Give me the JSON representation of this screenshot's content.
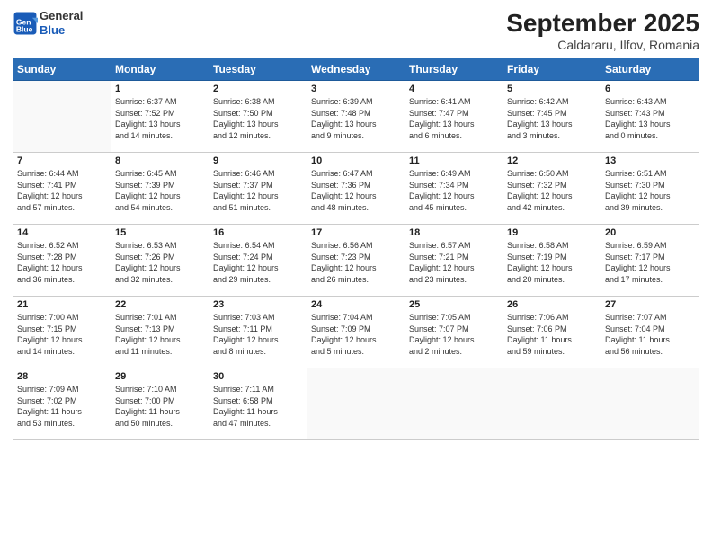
{
  "logo": {
    "general": "General",
    "blue": "Blue"
  },
  "title": "September 2025",
  "subtitle": "Caldararu, Ilfov, Romania",
  "weekdays": [
    "Sunday",
    "Monday",
    "Tuesday",
    "Wednesday",
    "Thursday",
    "Friday",
    "Saturday"
  ],
  "weeks": [
    [
      {
        "day": "",
        "info": ""
      },
      {
        "day": "1",
        "info": "Sunrise: 6:37 AM\nSunset: 7:52 PM\nDaylight: 13 hours\nand 14 minutes."
      },
      {
        "day": "2",
        "info": "Sunrise: 6:38 AM\nSunset: 7:50 PM\nDaylight: 13 hours\nand 12 minutes."
      },
      {
        "day": "3",
        "info": "Sunrise: 6:39 AM\nSunset: 7:48 PM\nDaylight: 13 hours\nand 9 minutes."
      },
      {
        "day": "4",
        "info": "Sunrise: 6:41 AM\nSunset: 7:47 PM\nDaylight: 13 hours\nand 6 minutes."
      },
      {
        "day": "5",
        "info": "Sunrise: 6:42 AM\nSunset: 7:45 PM\nDaylight: 13 hours\nand 3 minutes."
      },
      {
        "day": "6",
        "info": "Sunrise: 6:43 AM\nSunset: 7:43 PM\nDaylight: 13 hours\nand 0 minutes."
      }
    ],
    [
      {
        "day": "7",
        "info": "Sunrise: 6:44 AM\nSunset: 7:41 PM\nDaylight: 12 hours\nand 57 minutes."
      },
      {
        "day": "8",
        "info": "Sunrise: 6:45 AM\nSunset: 7:39 PM\nDaylight: 12 hours\nand 54 minutes."
      },
      {
        "day": "9",
        "info": "Sunrise: 6:46 AM\nSunset: 7:37 PM\nDaylight: 12 hours\nand 51 minutes."
      },
      {
        "day": "10",
        "info": "Sunrise: 6:47 AM\nSunset: 7:36 PM\nDaylight: 12 hours\nand 48 minutes."
      },
      {
        "day": "11",
        "info": "Sunrise: 6:49 AM\nSunset: 7:34 PM\nDaylight: 12 hours\nand 45 minutes."
      },
      {
        "day": "12",
        "info": "Sunrise: 6:50 AM\nSunset: 7:32 PM\nDaylight: 12 hours\nand 42 minutes."
      },
      {
        "day": "13",
        "info": "Sunrise: 6:51 AM\nSunset: 7:30 PM\nDaylight: 12 hours\nand 39 minutes."
      }
    ],
    [
      {
        "day": "14",
        "info": "Sunrise: 6:52 AM\nSunset: 7:28 PM\nDaylight: 12 hours\nand 36 minutes."
      },
      {
        "day": "15",
        "info": "Sunrise: 6:53 AM\nSunset: 7:26 PM\nDaylight: 12 hours\nand 32 minutes."
      },
      {
        "day": "16",
        "info": "Sunrise: 6:54 AM\nSunset: 7:24 PM\nDaylight: 12 hours\nand 29 minutes."
      },
      {
        "day": "17",
        "info": "Sunrise: 6:56 AM\nSunset: 7:23 PM\nDaylight: 12 hours\nand 26 minutes."
      },
      {
        "day": "18",
        "info": "Sunrise: 6:57 AM\nSunset: 7:21 PM\nDaylight: 12 hours\nand 23 minutes."
      },
      {
        "day": "19",
        "info": "Sunrise: 6:58 AM\nSunset: 7:19 PM\nDaylight: 12 hours\nand 20 minutes."
      },
      {
        "day": "20",
        "info": "Sunrise: 6:59 AM\nSunset: 7:17 PM\nDaylight: 12 hours\nand 17 minutes."
      }
    ],
    [
      {
        "day": "21",
        "info": "Sunrise: 7:00 AM\nSunset: 7:15 PM\nDaylight: 12 hours\nand 14 minutes."
      },
      {
        "day": "22",
        "info": "Sunrise: 7:01 AM\nSunset: 7:13 PM\nDaylight: 12 hours\nand 11 minutes."
      },
      {
        "day": "23",
        "info": "Sunrise: 7:03 AM\nSunset: 7:11 PM\nDaylight: 12 hours\nand 8 minutes."
      },
      {
        "day": "24",
        "info": "Sunrise: 7:04 AM\nSunset: 7:09 PM\nDaylight: 12 hours\nand 5 minutes."
      },
      {
        "day": "25",
        "info": "Sunrise: 7:05 AM\nSunset: 7:07 PM\nDaylight: 12 hours\nand 2 minutes."
      },
      {
        "day": "26",
        "info": "Sunrise: 7:06 AM\nSunset: 7:06 PM\nDaylight: 11 hours\nand 59 minutes."
      },
      {
        "day": "27",
        "info": "Sunrise: 7:07 AM\nSunset: 7:04 PM\nDaylight: 11 hours\nand 56 minutes."
      }
    ],
    [
      {
        "day": "28",
        "info": "Sunrise: 7:09 AM\nSunset: 7:02 PM\nDaylight: 11 hours\nand 53 minutes."
      },
      {
        "day": "29",
        "info": "Sunrise: 7:10 AM\nSunset: 7:00 PM\nDaylight: 11 hours\nand 50 minutes."
      },
      {
        "day": "30",
        "info": "Sunrise: 7:11 AM\nSunset: 6:58 PM\nDaylight: 11 hours\nand 47 minutes."
      },
      {
        "day": "",
        "info": ""
      },
      {
        "day": "",
        "info": ""
      },
      {
        "day": "",
        "info": ""
      },
      {
        "day": "",
        "info": ""
      }
    ]
  ]
}
